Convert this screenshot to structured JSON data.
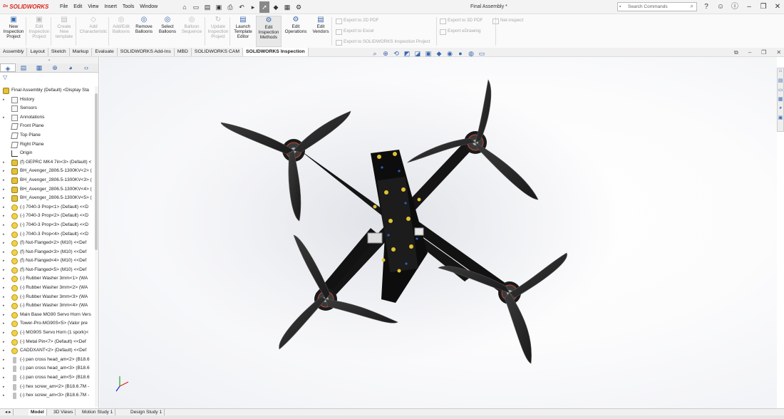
{
  "app": {
    "logo_brand": "SOLIDWORKS",
    "document_title": "Final Assembly *"
  },
  "menu": [
    "File",
    "Edit",
    "View",
    "Insert",
    "Tools",
    "Window"
  ],
  "search": {
    "placeholder": "Search Commands"
  },
  "ribbon": {
    "buttons": [
      {
        "id": "new-inspection-project",
        "label": "New\nInspection\nProject",
        "enabled": true
      },
      {
        "id": "edit-inspection-project",
        "label": "Edit\nInspection\nProject",
        "enabled": false
      },
      {
        "id": "create-new-template",
        "label": "Create\nNew\ntemplate",
        "enabled": false
      },
      {
        "id": "add-characteristic",
        "label": "Add\nCharacteristic",
        "enabled": false
      },
      {
        "id": "add-edit-balloons",
        "label": "Add/Edit\nBalloons",
        "enabled": false
      },
      {
        "id": "remove-balloons",
        "label": "Remove\nBalloons",
        "enabled": true
      },
      {
        "id": "select-balloons",
        "label": "Select\nBalloons",
        "enabled": true
      },
      {
        "id": "balloon-sequence",
        "label": "Balloon\nSequence",
        "enabled": false
      },
      {
        "id": "update-inspection-project",
        "label": "Update\nInspection\nProject",
        "enabled": false
      },
      {
        "id": "launch-template-editor",
        "label": "Launch\nTemplate\nEditor",
        "enabled": true
      },
      {
        "id": "edit-inspection-methods",
        "label": "Edit\nInspection\nMethods",
        "enabled": true
      },
      {
        "id": "edit-operations",
        "label": "Edit\nOperations",
        "enabled": true
      },
      {
        "id": "edit-vendors",
        "label": "Edit\nVendors",
        "enabled": true
      }
    ],
    "export_small": [
      "Export to 2D PDF",
      "Export to Excel",
      "Export to SOLIDWORKS Inspection Project"
    ],
    "export_small2": [
      "Export to 3D PDF",
      "Export eDrawing"
    ],
    "net_inspect": "Net-Inspect"
  },
  "tabs": [
    "Assembly",
    "Layout",
    "Sketch",
    "Markup",
    "Evaluate",
    "SOLIDWORKS Add-Ins",
    "MBD",
    "SOLIDWORKS CAM",
    "SOLIDWORKS Inspection"
  ],
  "active_tab": "SOLIDWORKS Inspection",
  "tree": [
    {
      "label": "Final Assembly (Default) <Display Sta",
      "icon": "asm",
      "level": 0
    },
    {
      "label": "History",
      "icon": "doc",
      "level": 1,
      "expand": true
    },
    {
      "label": "Sensors",
      "icon": "doc",
      "level": 1
    },
    {
      "label": "Annotations",
      "icon": "doc",
      "level": 1,
      "expand": true
    },
    {
      "label": "Front Plane",
      "icon": "plane",
      "level": 1
    },
    {
      "label": "Top Plane",
      "icon": "plane",
      "level": 1
    },
    {
      "label": "Right Plane",
      "icon": "plane",
      "level": 1
    },
    {
      "label": "Origin",
      "icon": "org",
      "level": 1
    },
    {
      "label": "(f) GEPRC MK4 7in<3> (Default) <",
      "icon": "asm",
      "level": 1,
      "expand": true
    },
    {
      "label": "BH_Avenger_2806.5-1300KV<2> (",
      "icon": "asm",
      "level": 1,
      "expand": true
    },
    {
      "label": "BH_Avenger_2806.5-1300KV<3> (",
      "icon": "asm",
      "level": 1,
      "expand": true
    },
    {
      "label": "BH_Avenger_2806.5-1300KV<4> (",
      "icon": "asm",
      "level": 1,
      "expand": true
    },
    {
      "label": "BH_Avenger_2806.5-1300KV<5> (",
      "icon": "asm",
      "level": 1,
      "expand": true
    },
    {
      "label": "(-) 7040-3 Prop<1> (Default) <<D",
      "icon": "part",
      "level": 1,
      "expand": true
    },
    {
      "label": "(-) 7040-3 Prop<2> (Default) <<D",
      "icon": "part",
      "level": 1,
      "expand": true
    },
    {
      "label": "(-) 7040-3 Prop<3> (Default) <<D",
      "icon": "part",
      "level": 1,
      "expand": true
    },
    {
      "label": "(-) 7040-3 Prop<4> (Default) <<D",
      "icon": "part",
      "level": 1,
      "expand": true
    },
    {
      "label": "(f) Nut-Flanged<2> (M10) <<Def",
      "icon": "part",
      "level": 1,
      "expand": true
    },
    {
      "label": "(f) Nut-Flanged<3> (M10) <<Def",
      "icon": "part",
      "level": 1,
      "expand": true
    },
    {
      "label": "(f) Nut-Flanged<4> (M10) <<Def",
      "icon": "part",
      "level": 1,
      "expand": true
    },
    {
      "label": "(f) Nut-Flanged<5> (M10) <<Def",
      "icon": "part",
      "level": 1,
      "expand": true
    },
    {
      "label": "(-) Rubber Washer 3mm<1> (WA",
      "icon": "part",
      "level": 1,
      "expand": true
    },
    {
      "label": "(-) Rubber Washer 3mm<2> (WA",
      "icon": "part",
      "level": 1,
      "expand": true
    },
    {
      "label": "(-) Rubber Washer 3mm<3> (WA",
      "icon": "part",
      "level": 1,
      "expand": true
    },
    {
      "label": "(-) Rubber Washer 3mm<4> (WA",
      "icon": "part",
      "level": 1,
      "expand": true
    },
    {
      "label": "Main Base MG90 Servo Horn Vers",
      "icon": "part",
      "level": 1,
      "expand": true
    },
    {
      "label": "Tower-Pro-MG90S<5> (Valor pre",
      "icon": "part",
      "level": 1,
      "expand": true
    },
    {
      "label": "(-) MG90S Servo Horn (1 spork)<",
      "icon": "part",
      "level": 1,
      "expand": true
    },
    {
      "label": "(-) Metal Pin<7> (Default) <<Def",
      "icon": "part",
      "level": 1,
      "expand": true
    },
    {
      "label": "CADDXANT<2> (Default) <<Def",
      "icon": "part",
      "level": 1,
      "expand": true
    },
    {
      "label": "(-) pan cross head_am<2> (B18.6",
      "icon": "scr",
      "level": 1,
      "expand": true
    },
    {
      "label": "(-) pan cross head_am<3> (B18.6",
      "icon": "scr",
      "level": 1,
      "expand": true
    },
    {
      "label": "(-) pan cross head_am<5> (B18.6",
      "icon": "scr",
      "level": 1,
      "expand": true
    },
    {
      "label": "(-) hex screw_am<2> (B18.6.7M -",
      "icon": "scr",
      "level": 1,
      "expand": true
    },
    {
      "label": "(-) hex screw_am<3> (B18.6.7M -",
      "icon": "scr",
      "level": 1,
      "expand": true
    }
  ],
  "bottom_tabs": [
    "Model",
    "3D Views",
    "Motion Study 1",
    "Design Study 1"
  ],
  "active_bottom_tab": "Model"
}
